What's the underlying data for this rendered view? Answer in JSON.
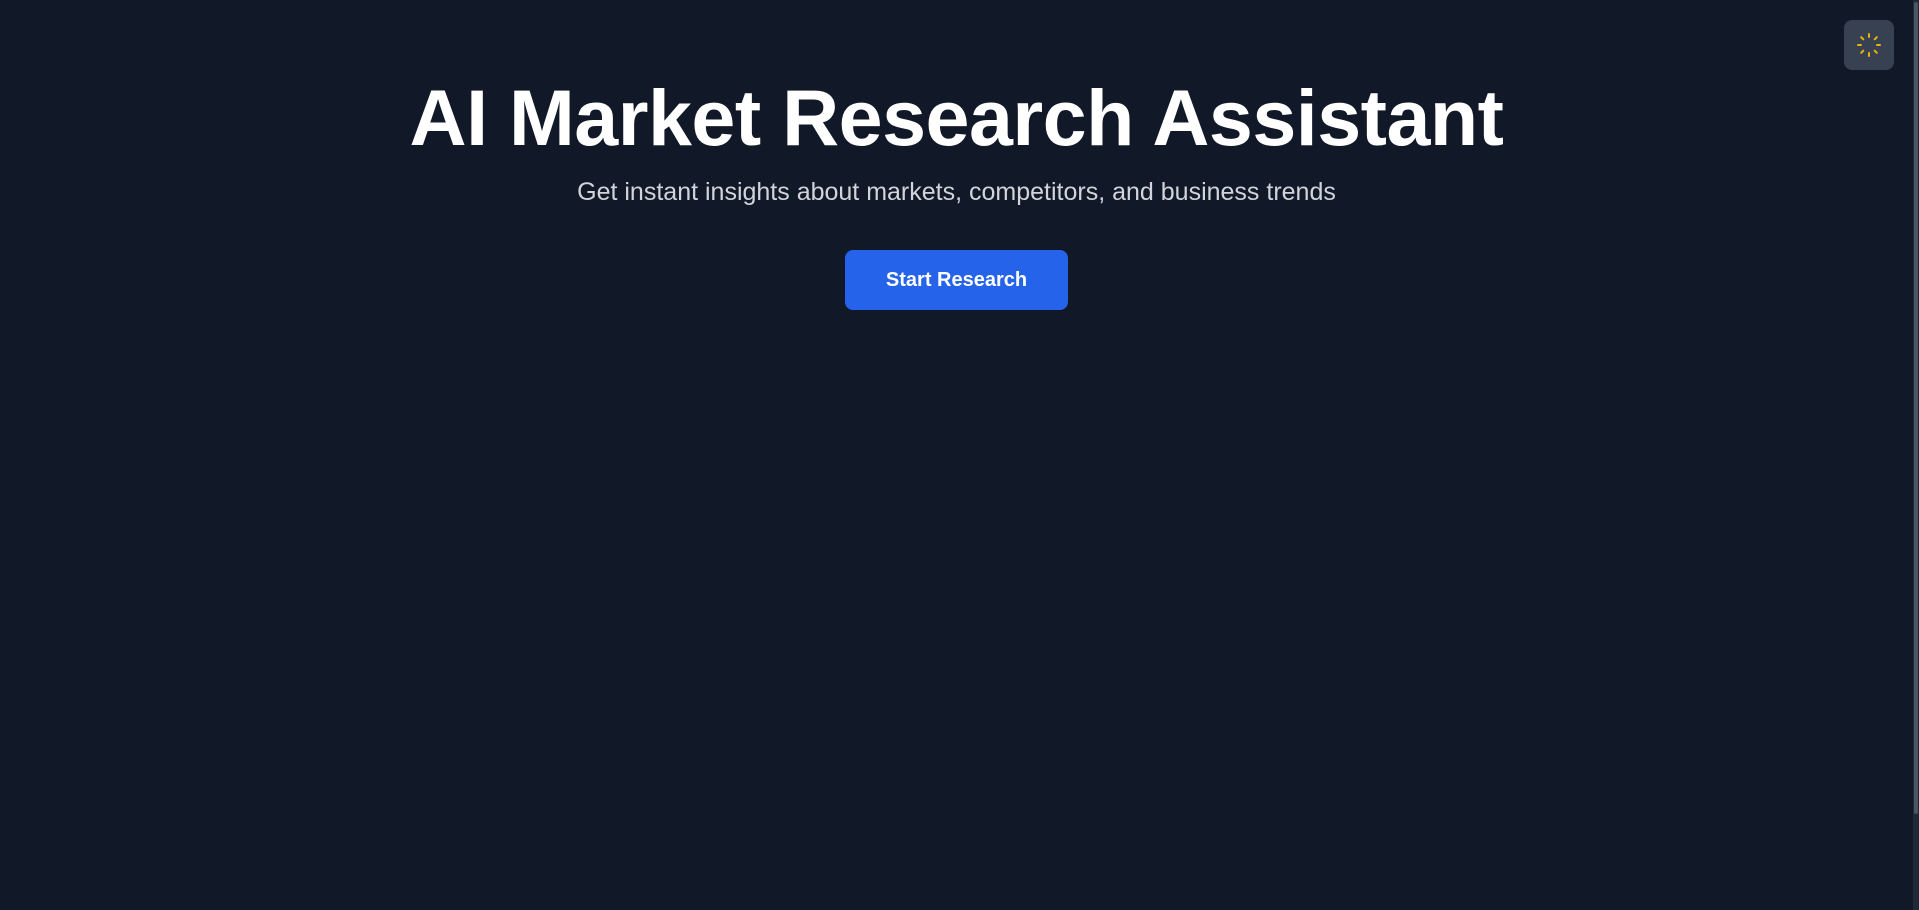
{
  "hero": {
    "title": "AI Market Research Assistant",
    "subtitle": "Get instant insights about markets, competitors, and business trends",
    "cta_label": "Start Research"
  },
  "theme_toggle": {
    "icon": "sun-icon",
    "icon_color": "#eab308"
  },
  "colors": {
    "background": "#111827",
    "accent": "#2563eb",
    "toggle_background": "#374151"
  }
}
